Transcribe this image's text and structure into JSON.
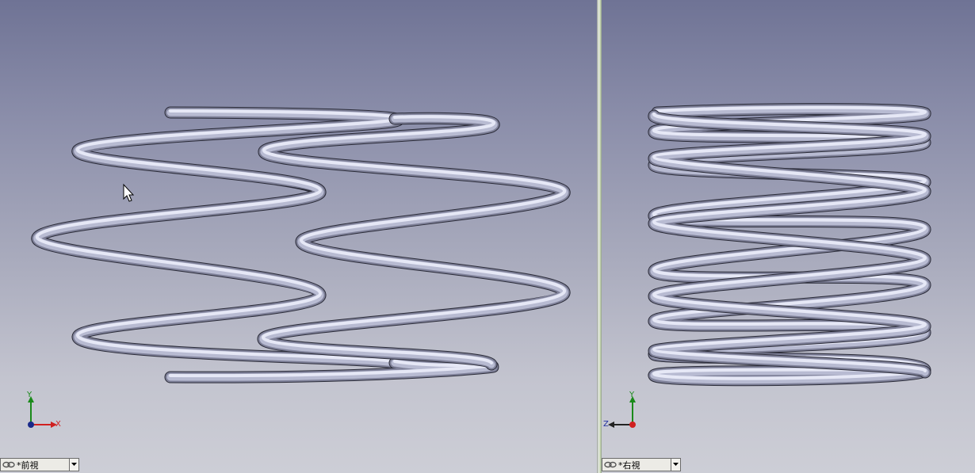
{
  "viewports": {
    "left": {
      "view_label": "*前視",
      "triad": {
        "up_axis": "Y",
        "right_axis": "X"
      }
    },
    "right": {
      "view_label": "*右視",
      "triad": {
        "up_axis": "Y",
        "left_axis": "Z"
      }
    }
  },
  "colors": {
    "background_top": "#6f7395",
    "background_bottom": "#cdced6",
    "spring": "#c8cbe0",
    "axis_y": "#1a8a1a",
    "axis_x": "#d02020",
    "axis_z": "#2030a0"
  }
}
